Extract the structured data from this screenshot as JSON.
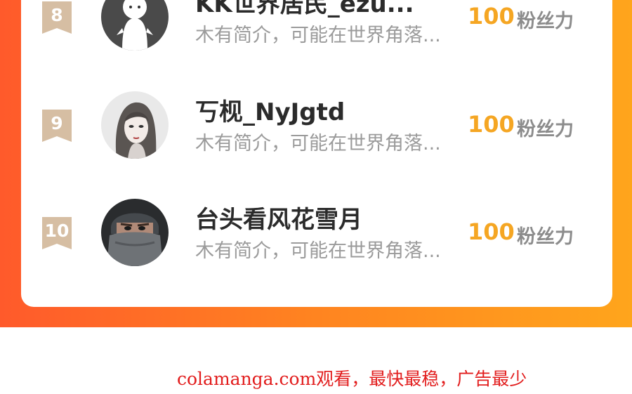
{
  "colors": {
    "gradient_start": "#ff5a2b",
    "gradient_end": "#ffa51c",
    "score": "#f5a623",
    "rank_badge": "#d6bea3",
    "watermark": "#e21d1d"
  },
  "leaderboard": {
    "rows": [
      {
        "rank": "8",
        "name": "KK世界居民_ezu...",
        "desc": "木有简介，可能在世界角落...",
        "score": "100",
        "unit": "粉丝力",
        "avatar": "ghost-avatar-icon"
      },
      {
        "rank": "9",
        "name": "丂枧_NyJgtd",
        "desc": "木有简介，可能在世界角落...",
        "score": "100",
        "unit": "粉丝力",
        "avatar": "sketch-portrait-avatar"
      },
      {
        "rank": "10",
        "name": "台头看风花雪月",
        "desc": "木有简介，可能在世界角落...",
        "score": "100",
        "unit": "粉丝力",
        "avatar": "masked-man-avatar"
      }
    ]
  },
  "footer": {
    "watermark": "colamanga.com观看，最快最稳，广告最少"
  }
}
